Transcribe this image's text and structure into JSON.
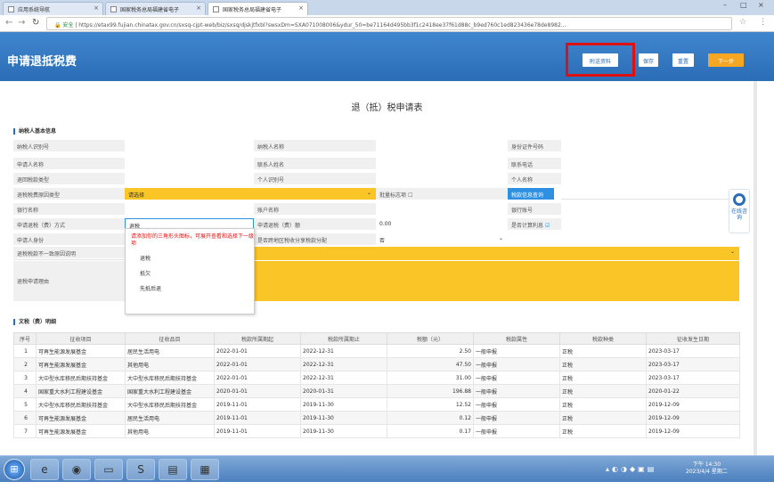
{
  "browser": {
    "tabs": [
      {
        "label": "应用系统导航"
      },
      {
        "label": "国家税务总局福建省电子"
      },
      {
        "label": "国家税务总局福建省电子"
      }
    ],
    "url": "https://etax99.fujian.chinatax.gov.cn/sxsq-cjpt-web/biz/sxsq/djskjtfxbl?swsxDm=SXA071008006&ydur_50=be71164d495bb3f1c2418ee37f61d88c_b9ed760c1ed823436e78de8982...",
    "secure_label": "安全"
  },
  "header": {
    "title": "申请退抵税费",
    "buttons": {
      "attach": "附送资料",
      "save": "保存",
      "reset": "重置",
      "next": "下一步"
    }
  },
  "form": {
    "title": "退（抵）税申请表",
    "section_basic": "纳税人基本信息",
    "rows": [
      {
        "l1": "纳税人识别号",
        "v1": "",
        "l2": "纳税人名称",
        "v2": "",
        "l3": "身份证件号码",
        "v3": ""
      },
      {
        "l1": "申请人名称",
        "v1": "",
        "l2": "联系人姓名",
        "v2": "",
        "l3": "联系电话",
        "v3": ""
      },
      {
        "l1": "退回税款类型",
        "v1": "",
        "l2": "个人识别号",
        "v2": "",
        "l3": "个人名称",
        "v3": ""
      },
      {
        "l1": "退税税费原因类型",
        "v1": "请选择",
        "l2": "批量标志项",
        "v2": "",
        "l3": "",
        "v3": "税款信息查询"
      },
      {
        "l1": "银行名称",
        "v1": "",
        "l2": "账户名称",
        "v2": "",
        "l3": "银行账号",
        "v3": ""
      },
      {
        "l1": "申请退税（费）方式",
        "v1": "退税",
        "l2": "申请退税（费）额",
        "v2": "0.00",
        "l3": "是否计算利息",
        "v3": ""
      },
      {
        "l1": "申请人身份",
        "v1": "",
        "l2": "是否跨地区税收分享税款分配",
        "v2": "否",
        "l3": "",
        "v3": ""
      },
      {
        "l1": "退税税款不一致原因说明",
        "v1": ""
      },
      {
        "l1": "退税申请理由",
        "v1": ""
      }
    ],
    "dropdown": {
      "warning": "请添加你的三角形头图标，可展开查看和选择下一级项",
      "options": [
        "退税",
        "抵欠",
        "先抵后退"
      ]
    },
    "section_detail": "文税（费）明细",
    "columns": [
      "序号",
      "征收项目",
      "征收品目",
      "税款所属期起",
      "税款所属期止",
      "税额（元）",
      "税款属性",
      "税款种类",
      "征收发生日期"
    ],
    "rows_detail": [
      [
        "1",
        "可再生能源发展基金",
        "居民生活用电",
        "2022-01-01",
        "2022-12-31",
        "2.50",
        "一般申报",
        "正税",
        "2023-03-17"
      ],
      [
        "2",
        "可再生能源发展基金",
        "其他用电",
        "2022-01-01",
        "2022-12-31",
        "47.50",
        "一般申报",
        "正税",
        "2023-03-17"
      ],
      [
        "3",
        "大中型水库移民后期扶持基金",
        "大中型水库移民后期扶持基金",
        "2022-01-01",
        "2022-12-31",
        "31.00",
        "一般申报",
        "正税",
        "2023-03-17"
      ],
      [
        "4",
        "国家重大水利工程建设基金",
        "国家重大水利工程建设基金",
        "2020-01-01",
        "2020-01-31",
        "196.88",
        "一般申报",
        "正税",
        "2020-01-22"
      ],
      [
        "5",
        "大中型水库移民后期扶持基金",
        "大中型水库移民后期扶持基金",
        "2019-11-01",
        "2019-11-30",
        "12.52",
        "一般申报",
        "正税",
        "2019-12-09"
      ],
      [
        "6",
        "可再生能源发展基金",
        "居民生活用电",
        "2019-11-01",
        "2019-11-30",
        "0.12",
        "一般申报",
        "正税",
        "2019-12-09"
      ],
      [
        "7",
        "可再生能源发展基金",
        "其他用电",
        "2019-11-01",
        "2019-11-30",
        "0.17",
        "一般申报",
        "正税",
        "2019-12-09"
      ]
    ]
  },
  "float_service": {
    "label": "在线咨询"
  },
  "taskbar": {
    "time": "下午 14:30",
    "date": "2023/4/4 星期二"
  },
  "colors": {
    "header": "#2b6db6",
    "accent": "#f9c527",
    "next_button": "#f5a623",
    "highlight_box": "#e01010"
  }
}
